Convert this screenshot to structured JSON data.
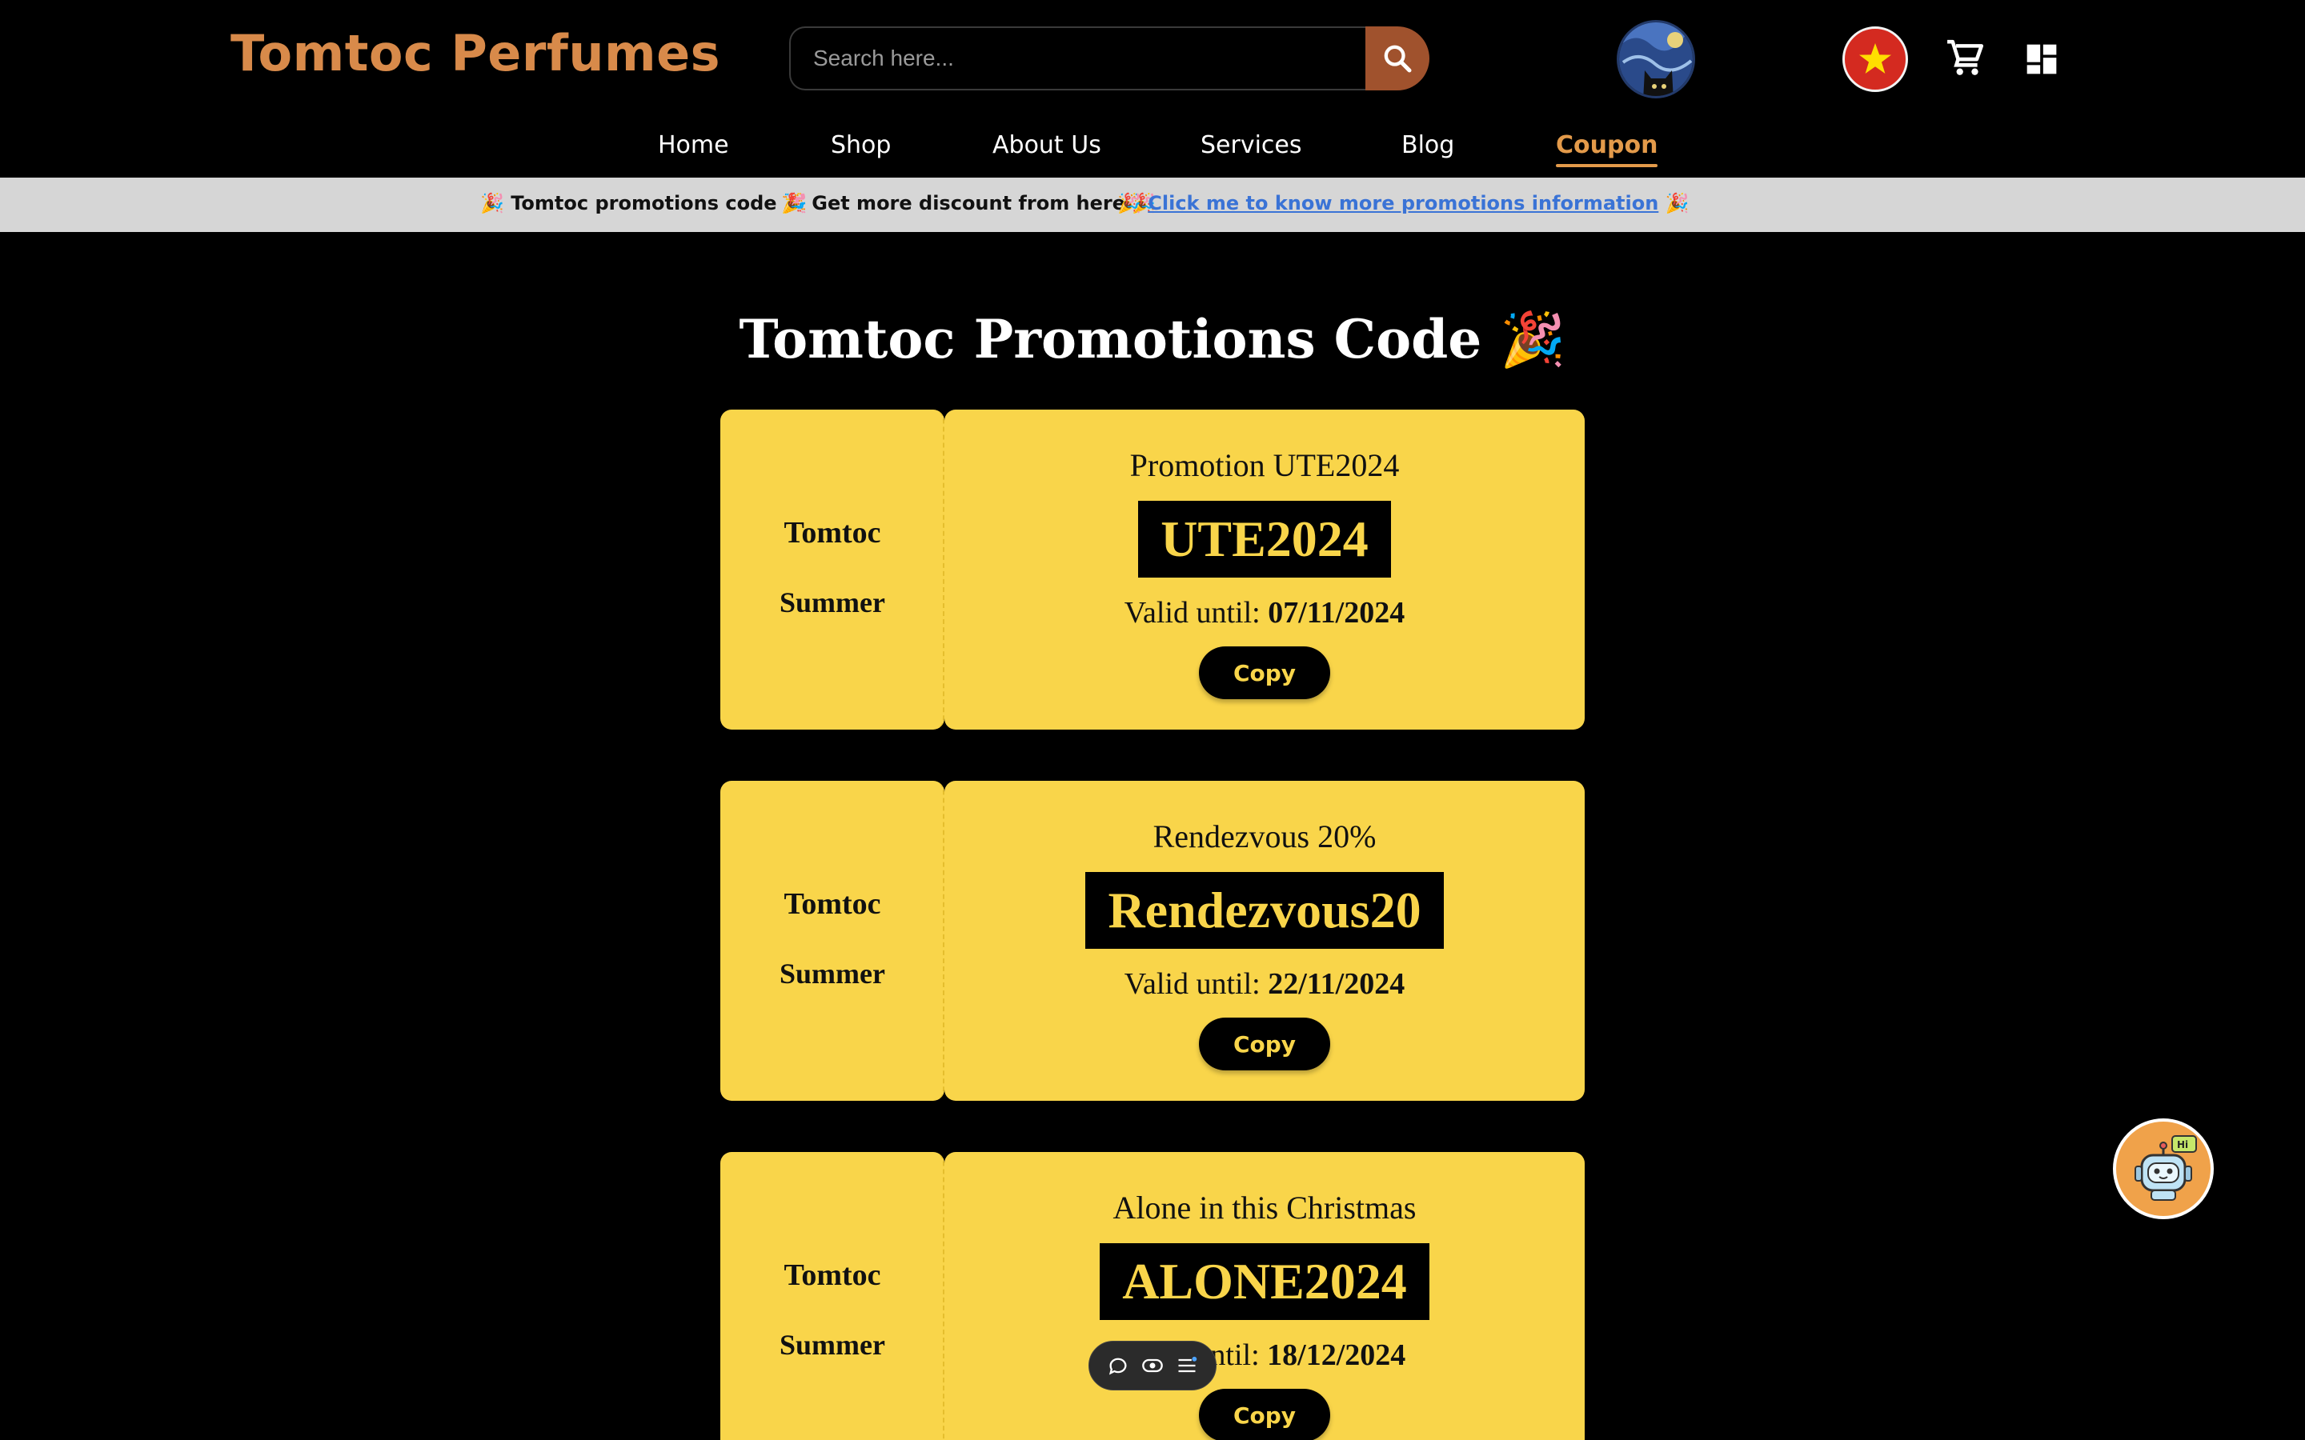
{
  "header": {
    "logo": "Tomtoc Perfumes",
    "search_placeholder": "Search here...",
    "icons": [
      "search-icon",
      "avatar",
      "vietnam-flag-icon",
      "cart-icon",
      "dashboard-icon"
    ]
  },
  "nav": {
    "items": [
      "Home",
      "Shop",
      "About Us",
      "Services",
      "Blog",
      "Coupon"
    ],
    "active": "Coupon"
  },
  "promo_bar": {
    "item1": "Tomtoc promotions code",
    "item2": "Get more discount from here",
    "item3": "Click me to know more promotions information",
    "emoji": "🎉"
  },
  "main": {
    "title": "Tomtoc Promotions Code",
    "title_emoji": "🎉"
  },
  "coupons": [
    {
      "left_top": "Tomtoc",
      "left_bottom": "Summer",
      "name": "Promotion UTE2024",
      "code": "UTE2024",
      "valid_label": "Valid until:",
      "valid_date": "07/11/2024",
      "button": "Copy"
    },
    {
      "left_top": "Tomtoc",
      "left_bottom": "Summer",
      "name": "Rendezvous 20%",
      "code": "Rendezvous20",
      "valid_label": "Valid until:",
      "valid_date": "22/11/2024",
      "button": "Copy"
    },
    {
      "left_top": "Tomtoc",
      "left_bottom": "Summer",
      "name": "Alone in this Christmas",
      "code": "ALONE2024",
      "valid_label": "Valid until:",
      "valid_date": "18/12/2024",
      "button": "Copy"
    }
  ],
  "colors": {
    "accent": "#e39a4a",
    "logo": "#d88a4a",
    "coupon_bg": "#f9d54a",
    "search_button": "#a0522d",
    "promo_bar": "#d6d6d6",
    "link": "#3a73d6"
  }
}
